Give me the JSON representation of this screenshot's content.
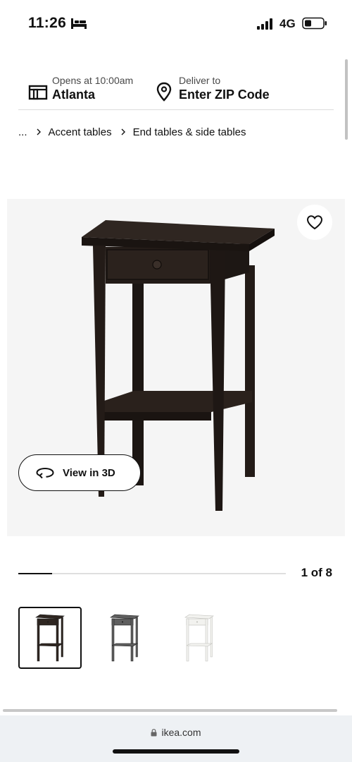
{
  "status_bar": {
    "time": "11:26",
    "network": "4G",
    "icons": [
      "bed-icon",
      "signal-icon",
      "battery-icon"
    ]
  },
  "store": {
    "hours": "Opens at 10:00am",
    "name": "Atlanta",
    "icon": "store-icon"
  },
  "delivery": {
    "label": "Deliver to",
    "action": "Enter ZIP Code",
    "icon": "pin-icon"
  },
  "breadcrumb": [
    "...",
    "Accent tables",
    "End tables & side tables"
  ],
  "media": {
    "view3d_label": "View in 3D",
    "favorite_icon": "heart-icon",
    "view3d_icon": "rotate-icon",
    "current_slide": 1,
    "total_slides": 8,
    "counter_text": "1 of 8",
    "progress_fraction": 0.125
  },
  "thumbnails": [
    {
      "finish": "black-brown",
      "color": "#2f2621",
      "selected": true
    },
    {
      "finish": "dark gray",
      "color": "#5f5f5f",
      "selected": false
    },
    {
      "finish": "white",
      "color": "#f2f2ef",
      "selected": false
    }
  ],
  "browser": {
    "url": "ikea.com",
    "lock_icon": "lock-icon"
  },
  "colors": {
    "text": "#111111",
    "product_background": "#f5f5f5",
    "browser_bar": "#eef1f4"
  }
}
